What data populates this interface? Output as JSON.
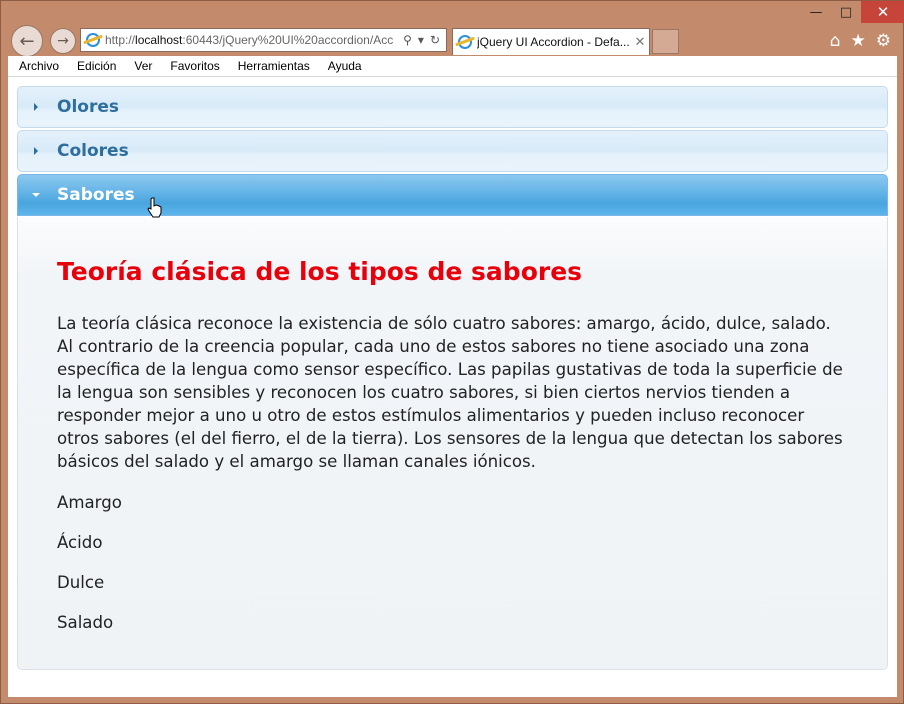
{
  "browser": {
    "address_prefix": "http://",
    "address_host": "localhost",
    "address_rest": ":60443/jQuery%20UI%20accordion/Acc",
    "tab_title": "jQuery UI Accordion - Defa...",
    "menu": [
      "Archivo",
      "Edición",
      "Ver",
      "Favoritos",
      "Herramientas",
      "Ayuda"
    ]
  },
  "accordion": {
    "sections": [
      {
        "label": "Olores",
        "active": false
      },
      {
        "label": "Colores",
        "active": false
      },
      {
        "label": "Sabores",
        "active": true
      }
    ],
    "panel": {
      "heading": "Teoría clásica de los tipos de sabores",
      "paragraph": "La teoría clásica reconoce la existencia de sólo cuatro sabores: amargo, ácido, dulce, salado. Al contrario de la creencia popular, cada uno de estos sabores no tiene asociado una zona específica de la lengua como sensor específico. Las papilas gustativas de toda la superficie de la lengua son sensibles y reconocen los cuatro sabores, si bien ciertos nervios tienden a responder mejor a uno u otro de estos estímulos alimentarios y pueden incluso reconocer otros sabores (el del fierro, el de la tierra). Los sensores de la lengua que detectan los sabores básicos del salado y el amargo se llaman canales iónicos.",
      "items": [
        "Amargo",
        "Ácido",
        "Dulce",
        "Salado"
      ]
    }
  },
  "colors": {
    "heading": "#e8000b",
    "header_text": "#2e6e9e",
    "active_header": "#4aa5df"
  }
}
